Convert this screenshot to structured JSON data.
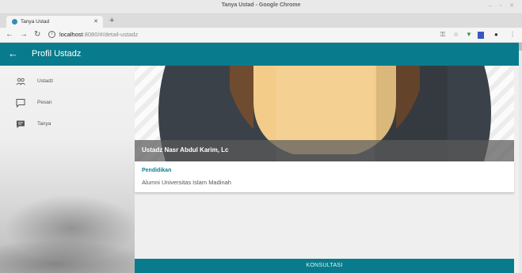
{
  "window": {
    "title": "Tanya Ustad - Google Chrome"
  },
  "browser": {
    "tab_title": "Tanya Ustad",
    "url_host": "localhost",
    "url_rest": ":8080/#/detail-ustadz"
  },
  "app": {
    "title": "Profil Ustadz",
    "accent_color": "#087c8c"
  },
  "sidebar": {
    "items": [
      {
        "label": "Ustadz",
        "icon": "people-icon"
      },
      {
        "label": "Pesan",
        "icon": "chat-bubble-icon"
      },
      {
        "label": "Tanya",
        "icon": "message-icon"
      }
    ]
  },
  "profile": {
    "name": "Ustadz Nasr Abdul Karim, Lc",
    "section_label": "Pendidikan",
    "section_value": "Alumni Universitas Islam Madinah"
  },
  "actions": {
    "consult_label": "KONSULTASI"
  }
}
